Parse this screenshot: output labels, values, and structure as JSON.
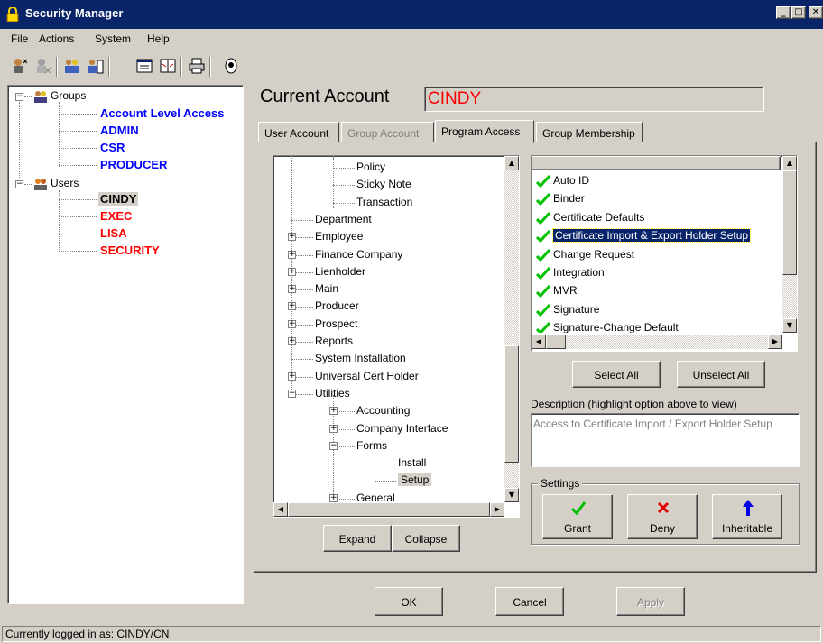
{
  "window": {
    "title": "Security Manager",
    "min_label": "_",
    "max_label": "□",
    "close_label": "✕"
  },
  "menu": [
    "File",
    "Actions",
    "System",
    "Help"
  ],
  "groups_tree": {
    "groups_label": "Groups",
    "groups": [
      "Account Level Access",
      "ADMIN",
      "CSR",
      "PRODUCER"
    ],
    "users_label": "Users",
    "users": [
      "CINDY",
      "EXEC",
      "LISA",
      "SECURITY"
    ]
  },
  "current_account": {
    "label": "Current Account",
    "value": "CINDY"
  },
  "tabs": [
    "User Account",
    "Group Account",
    "Program Access",
    "Group Membership"
  ],
  "program_tree": {
    "items": [
      {
        "label": "Policy"
      },
      {
        "label": "Sticky Note"
      },
      {
        "label": "Transaction"
      },
      {
        "label": "Department"
      },
      {
        "label": "Employee"
      },
      {
        "label": "Finance Company"
      },
      {
        "label": "Lienholder"
      },
      {
        "label": "Main"
      },
      {
        "label": "Producer"
      },
      {
        "label": "Prospect"
      },
      {
        "label": "Reports"
      },
      {
        "label": "System Installation"
      },
      {
        "label": "Universal Cert Holder"
      },
      {
        "label": "Utilities"
      },
      {
        "label": "Accounting"
      },
      {
        "label": "Company Interface"
      },
      {
        "label": "Forms"
      },
      {
        "label": "Install"
      },
      {
        "label": "Setup"
      },
      {
        "label": "General"
      }
    ]
  },
  "permissions": {
    "items": [
      "Auto ID",
      "Binder",
      "Certificate Defaults",
      "Certificate Import & Export Holder Setup",
      "Change Request",
      "Integration",
      "MVR",
      "Signature",
      "Signature-Change Default"
    ],
    "selected": "Certificate Import & Export Holder Setup"
  },
  "buttons": {
    "expand": "Expand",
    "collapse": "Collapse",
    "select_all": "Select All",
    "unselect_all": "Unselect All",
    "ok": "OK",
    "cancel": "Cancel",
    "apply": "Apply"
  },
  "description": {
    "label": "Description (highlight option above to view)",
    "text": "Access to Certificate Import / Export Holder Setup"
  },
  "settings": {
    "label": "Settings",
    "grant": "Grant",
    "deny": "Deny",
    "inheritable": "Inheritable"
  },
  "status": "Currently logged in as: CINDY/CN",
  "colors": {
    "title_bar": "#0a246a",
    "group_text": "#0000ff",
    "user_text": "#ff0000",
    "grant_check": "#00c000"
  }
}
